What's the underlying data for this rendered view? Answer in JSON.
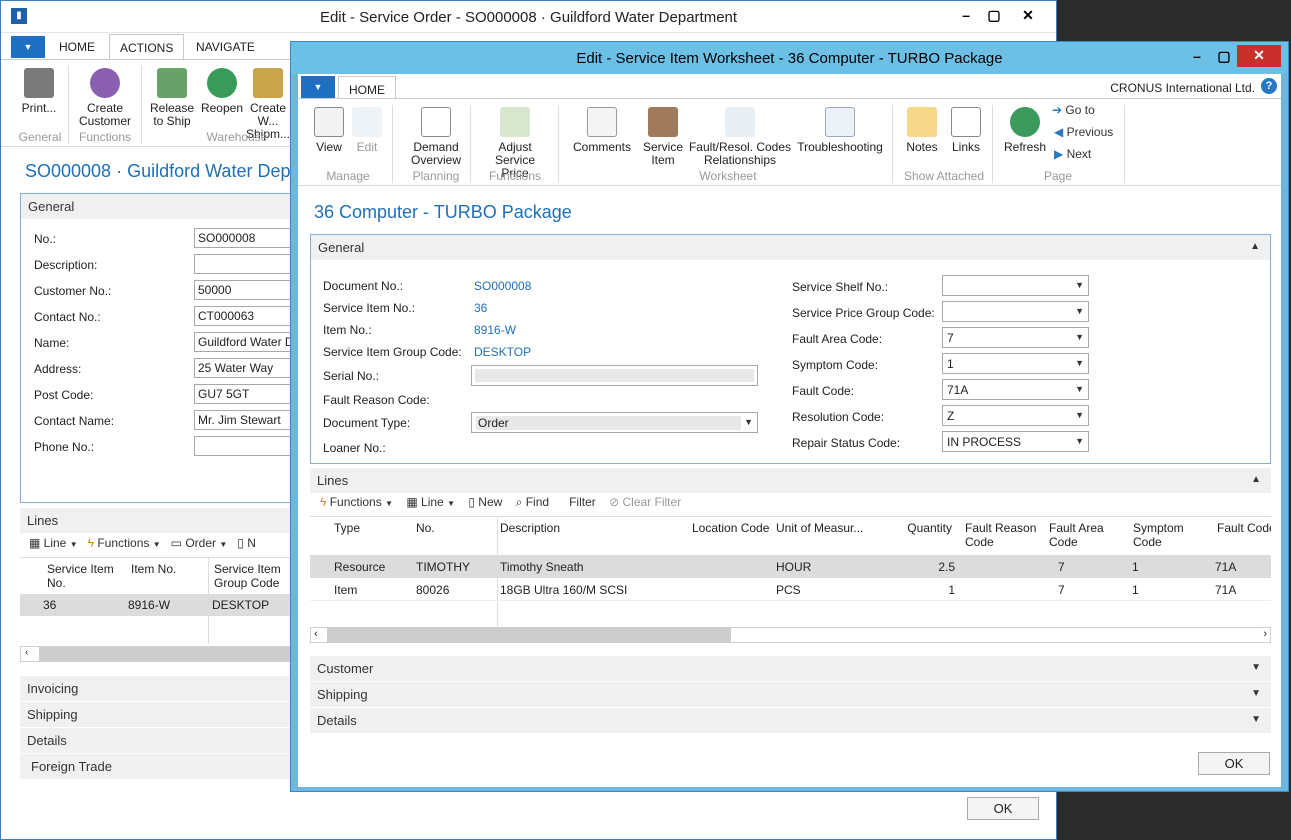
{
  "back_window": {
    "title": "Edit - Service Order - SO000008 · Guildford Water Department",
    "tabs": [
      "HOME",
      "ACTIONS",
      "NAVIGATE"
    ],
    "ribbon": {
      "print": "Print...",
      "create_customer": "Create Customer",
      "release": "Release to Ship",
      "reopen": "Reopen",
      "create_whse": "Create W... Shipm...",
      "group_general": "General",
      "group_functions": "Functions",
      "group_warehouse": "Warehouse"
    },
    "page_title": "SO000008 · Guildford Water Depa",
    "general_label": "General",
    "fields": [
      {
        "label": "No.:",
        "value": "SO000008"
      },
      {
        "label": "Description:",
        "value": ""
      },
      {
        "label": "Customer No.:",
        "value": "50000"
      },
      {
        "label": "Contact No.:",
        "value": "CT000063"
      },
      {
        "label": "Name:",
        "value": "Guildford Water D"
      },
      {
        "label": "Address:",
        "value": "25 Water Way"
      },
      {
        "label": "Post Code:",
        "value": "GU7 5GT"
      },
      {
        "label": "Contact Name:",
        "value": "Mr. Jim Stewart"
      },
      {
        "label": "Phone No.:",
        "value": ""
      }
    ],
    "lines_label": "Lines",
    "lines_toolbar": {
      "line": "Line",
      "functions": "Functions",
      "order": "Order",
      "new": "N"
    },
    "lines_headers": [
      "Service Item No.",
      "Item No.",
      "Service Item Group Code"
    ],
    "lines_row": [
      "36",
      "8916-W",
      "DESKTOP"
    ],
    "sections": [
      "Invoicing",
      "Shipping",
      "Details",
      "Foreign Trade"
    ],
    "ok": "OK"
  },
  "front_window": {
    "title": "Edit - Service Item Worksheet - 36 Computer - TURBO Package",
    "tab": "HOME",
    "company": "CRONUS International Ltd.",
    "ribbon": {
      "view": "View",
      "edit": "Edit",
      "demand": "Demand Overview",
      "adjust": "Adjust Service Price",
      "comments": "Comments",
      "service_item": "Service Item",
      "fault": "Fault/Resol. Codes Relationships",
      "troubleshooting": "Troubleshooting",
      "notes": "Notes",
      "links": "Links",
      "refresh": "Refresh",
      "goto": "Go to",
      "previous": "Previous",
      "next": "Next",
      "g_manage": "Manage",
      "g_planning": "Planning",
      "g_functions": "Functions",
      "g_worksheet": "Worksheet",
      "g_show": "Show Attached",
      "g_page": "Page"
    },
    "page_title": "36 Computer - TURBO Package",
    "general_label": "General",
    "left_fields": [
      {
        "label": "Document No.:",
        "value": "SO000008"
      },
      {
        "label": "Service Item No.:",
        "value": "36"
      },
      {
        "label": "Item No.:",
        "value": "8916-W"
      },
      {
        "label": "Service Item Group Code:",
        "value": "DESKTOP"
      },
      {
        "label": "Serial No.:",
        "value": ""
      },
      {
        "label": "Fault Reason Code:",
        "value": ""
      },
      {
        "label": "Document Type:",
        "value": "Order"
      },
      {
        "label": "Loaner No.:",
        "value": ""
      }
    ],
    "right_fields": [
      {
        "label": "Service Shelf No.:",
        "value": ""
      },
      {
        "label": "Service Price Group Code:",
        "value": ""
      },
      {
        "label": "Fault Area Code:",
        "value": "7"
      },
      {
        "label": "Symptom Code:",
        "value": "1"
      },
      {
        "label": "Fault Code:",
        "value": "71A"
      },
      {
        "label": "Resolution Code:",
        "value": "Z"
      },
      {
        "label": "Repair Status Code:",
        "value": "IN PROCESS"
      }
    ],
    "lines_label": "Lines",
    "lines_toolbar": {
      "functions": "Functions",
      "line": "Line",
      "new": "New",
      "find": "Find",
      "filter": "Filter",
      "clear": "Clear Filter"
    },
    "columns": [
      "Type",
      "No.",
      "Description",
      "Location Code",
      "Unit of Measur...",
      "Quantity",
      "Fault Reason Code",
      "Fault Area Code",
      "Symptom Code",
      "Fault Code"
    ],
    "rows": [
      [
        "Resource",
        "TIMOTHY",
        "Timothy Sneath",
        "",
        "HOUR",
        "2.5",
        "",
        "7",
        "1",
        "71A"
      ],
      [
        "Item",
        "80026",
        "18GB Ultra 160/M SCSI",
        "",
        "PCS",
        "1",
        "",
        "7",
        "1",
        "71A"
      ]
    ],
    "sections": [
      "Customer",
      "Shipping",
      "Details"
    ],
    "ok": "OK"
  }
}
